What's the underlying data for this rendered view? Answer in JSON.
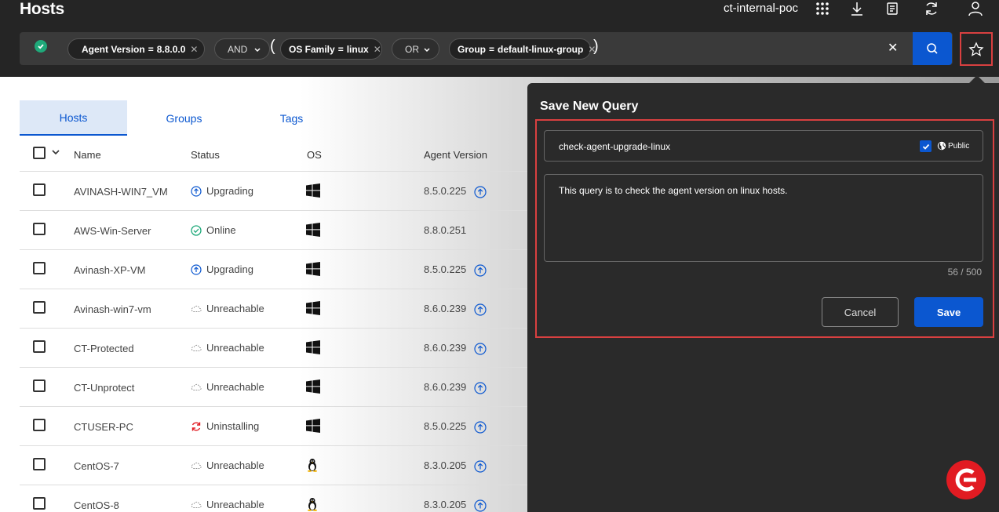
{
  "header": {
    "title": "Hosts",
    "tenant": "ct-internal-poc",
    "icons": [
      "apps-grid-icon",
      "download-icon",
      "document-icon",
      "refresh-icon",
      "user-icon"
    ]
  },
  "query": {
    "chips": [
      {
        "field": "Agent Version",
        "op": "=",
        "value": "8.8.0.0",
        "pinned": true
      },
      {
        "field": "OS Family",
        "op": "=",
        "value": "linux"
      },
      {
        "field": "Group",
        "op": "=",
        "value": "default-linux-group"
      }
    ],
    "and_label": "AND",
    "or_label": "OR",
    "open_paren": "(",
    "close_paren": ")"
  },
  "tabs": [
    {
      "label": "Hosts",
      "active": true
    },
    {
      "label": "Groups",
      "active": false
    },
    {
      "label": "Tags",
      "active": false
    }
  ],
  "table": {
    "columns": [
      "Name",
      "Status",
      "OS",
      "Agent Version"
    ],
    "rows": [
      {
        "name": "AVINASH-WIN7_VM",
        "status": "Upgrading",
        "status_kind": "upgrading",
        "os": "windows",
        "version": "8.5.0.225",
        "upgrade": true
      },
      {
        "name": "AWS-Win-Server",
        "status": "Online",
        "status_kind": "online",
        "os": "windows",
        "version": "8.8.0.251",
        "upgrade": false
      },
      {
        "name": "Avinash-XP-VM",
        "status": "Upgrading",
        "status_kind": "upgrading",
        "os": "windows",
        "version": "8.5.0.225",
        "upgrade": true
      },
      {
        "name": "Avinash-win7-vm",
        "status": "Unreachable",
        "status_kind": "unreachable",
        "os": "windows",
        "version": "8.6.0.239",
        "upgrade": true
      },
      {
        "name": "CT-Protected",
        "status": "Unreachable",
        "status_kind": "unreachable",
        "os": "windows",
        "version": "8.6.0.239",
        "upgrade": true
      },
      {
        "name": "CT-Unprotect",
        "status": "Unreachable",
        "status_kind": "unreachable",
        "os": "windows",
        "version": "8.6.0.239",
        "upgrade": true
      },
      {
        "name": "CTUSER-PC",
        "status": "Uninstalling",
        "status_kind": "uninstalling",
        "os": "windows",
        "version": "8.5.0.225",
        "upgrade": true
      },
      {
        "name": "CentOS-7",
        "status": "Unreachable",
        "status_kind": "unreachable",
        "os": "linux",
        "version": "8.3.0.205",
        "upgrade": true
      },
      {
        "name": "CentOS-8",
        "status": "Unreachable",
        "status_kind": "unreachable",
        "os": "linux",
        "version": "8.3.0.205",
        "upgrade": true
      }
    ]
  },
  "save_query": {
    "title": "Save New Query",
    "name_value": "check-agent-upgrade-linux",
    "public_label": "Public",
    "public_checked": true,
    "description_value": "This query is to check the agent version on linux hosts.",
    "counter": "56 / 500",
    "cancel_label": "Cancel",
    "save_label": "Save"
  },
  "colors": {
    "accent": "#0b57d0",
    "online": "#1fa97a",
    "uninstalling": "#e11b22",
    "highlight": "#d94040"
  }
}
